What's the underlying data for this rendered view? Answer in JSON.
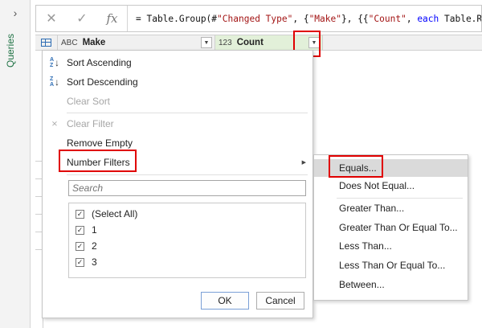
{
  "queries_pane": {
    "label": "Queries",
    "collapse_icon": "chevron-right-icon"
  },
  "formula_bar": {
    "cancel_icon": "close-icon",
    "confirm_icon": "checkmark-icon",
    "fx_label": "fx",
    "formula_prefix": "= Table.Group(#",
    "formula_str1": "\"Changed Type\"",
    "formula_mid": ", {",
    "formula_str2": "\"Make\"",
    "formula_mid2": "}, {{",
    "formula_str3": "\"Count\"",
    "formula_mid3": ", ",
    "formula_kw": "each",
    "formula_tail": " Table.Row"
  },
  "grid": {
    "columns": [
      {
        "type_icon": "ABC",
        "name": "Make"
      },
      {
        "type_icon": "123",
        "name": "Count"
      }
    ]
  },
  "filter_menu": {
    "sort_ascending": "Sort Ascending",
    "sort_descending": "Sort Descending",
    "clear_sort": "Clear Sort",
    "clear_filter": "Clear Filter",
    "remove_empty": "Remove Empty",
    "number_filters": "Number Filters",
    "search_placeholder": "Search",
    "values": [
      {
        "label": "(Select All)",
        "checked": true
      },
      {
        "label": "1",
        "checked": true
      },
      {
        "label": "2",
        "checked": true
      },
      {
        "label": "3",
        "checked": true
      }
    ],
    "ok_label": "OK",
    "cancel_label": "Cancel"
  },
  "number_filters_submenu": {
    "items": [
      "Equals...",
      "Does Not Equal...",
      "Greater Than...",
      "Greater Than Or Equal To...",
      "Less Than...",
      "Less Than Or Equal To...",
      "Between..."
    ],
    "highlighted": "Equals..."
  },
  "colors": {
    "accent_green": "#217346",
    "highlight_red": "#e00000",
    "count_header_bg": "#e2f0d9",
    "icon_blue": "#2e6db4"
  }
}
